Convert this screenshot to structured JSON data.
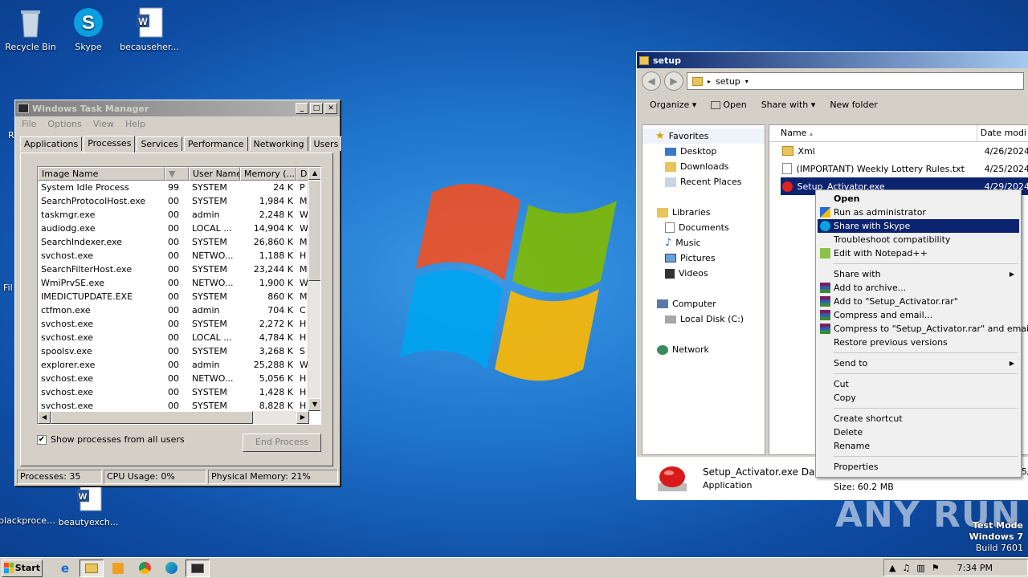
{
  "desktop": {
    "icons": [
      {
        "label": "Recycle Bin",
        "icon": "recycle-bin-icon"
      },
      {
        "label": "Skype",
        "icon": "skype-icon"
      },
      {
        "label": "becauseher...",
        "icon": "word-doc-icon"
      },
      {
        "label": "blackproces...",
        "icon": "blank-doc-icon"
      },
      {
        "label": "beautyexch...",
        "icon": "word-doc-icon"
      }
    ],
    "partial_labels": [
      "R",
      "File"
    ]
  },
  "task_manager": {
    "title": "Windows Task Manager",
    "menu": [
      "File",
      "Options",
      "View",
      "Help"
    ],
    "tabs": [
      "Applications",
      "Processes",
      "Services",
      "Performance",
      "Networking",
      "Users"
    ],
    "active_tab": "Processes",
    "columns": [
      "Image Name",
      "User Name",
      "Memory (...",
      "D"
    ],
    "rows": [
      {
        "name": "System Idle Process",
        "cpu": "99",
        "user": "SYSTEM",
        "mem": "24 K",
        "d": "P"
      },
      {
        "name": "SearchProtocolHost.exe",
        "cpu": "00",
        "user": "SYSTEM",
        "mem": "1,984 K",
        "d": "M"
      },
      {
        "name": "taskmgr.exe",
        "cpu": "00",
        "user": "admin",
        "mem": "2,248 K",
        "d": "W"
      },
      {
        "name": "audiodg.exe",
        "cpu": "00",
        "user": "LOCAL ...",
        "mem": "14,904 K",
        "d": "W"
      },
      {
        "name": "SearchIndexer.exe",
        "cpu": "00",
        "user": "SYSTEM",
        "mem": "26,860 K",
        "d": "M"
      },
      {
        "name": "svchost.exe",
        "cpu": "00",
        "user": "NETWO...",
        "mem": "1,188 K",
        "d": "H"
      },
      {
        "name": "SearchFilterHost.exe",
        "cpu": "00",
        "user": "SYSTEM",
        "mem": "23,244 K",
        "d": "M"
      },
      {
        "name": "WmiPrvSE.exe",
        "cpu": "00",
        "user": "NETWO...",
        "mem": "1,900 K",
        "d": "W"
      },
      {
        "name": "IMEDICTUPDATE.EXE",
        "cpu": "00",
        "user": "SYSTEM",
        "mem": "860 K",
        "d": "M"
      },
      {
        "name": "ctfmon.exe",
        "cpu": "00",
        "user": "admin",
        "mem": "704 K",
        "d": "C"
      },
      {
        "name": "svchost.exe",
        "cpu": "00",
        "user": "SYSTEM",
        "mem": "2,272 K",
        "d": "H"
      },
      {
        "name": "svchost.exe",
        "cpu": "00",
        "user": "LOCAL ...",
        "mem": "4,784 K",
        "d": "H"
      },
      {
        "name": "spoolsv.exe",
        "cpu": "00",
        "user": "SYSTEM",
        "mem": "3,268 K",
        "d": "S"
      },
      {
        "name": "explorer.exe",
        "cpu": "00",
        "user": "admin",
        "mem": "25,288 K",
        "d": "W"
      },
      {
        "name": "svchost.exe",
        "cpu": "00",
        "user": "NETWO...",
        "mem": "5,056 K",
        "d": "H"
      },
      {
        "name": "svchost.exe",
        "cpu": "00",
        "user": "SYSTEM",
        "mem": "1,428 K",
        "d": "H"
      },
      {
        "name": "svchost.exe",
        "cpu": "00",
        "user": "SYSTEM",
        "mem": "8,828 K",
        "d": "H"
      }
    ],
    "show_all_label": "Show processes from all users",
    "show_all_checked": "✔",
    "end_process_label": "End Process",
    "status": {
      "processes": "Processes: 35",
      "cpu": "CPU Usage: 0%",
      "memory": "Physical Memory: 21%"
    }
  },
  "explorer": {
    "title": "setup",
    "address": "setup",
    "commands": [
      "Organize",
      "Open",
      "Share with",
      "New folder"
    ],
    "nav": {
      "favorites": "Favorites",
      "fav_items": [
        "Desktop",
        "Downloads",
        "Recent Places"
      ],
      "libraries": "Libraries",
      "lib_items": [
        "Documents",
        "Music",
        "Pictures",
        "Videos"
      ],
      "computer": "Computer",
      "comp_items": [
        "Local Disk (C:)"
      ],
      "network": "Network"
    },
    "columns": [
      "Name",
      "Date modi"
    ],
    "files": [
      {
        "name": "Xml",
        "date": "4/26/2024",
        "icon": "folder-icon"
      },
      {
        "name": "(IMPORTANT) Weekly Lottery Rules.txt",
        "date": "4/25/2024",
        "icon": "text-file-icon"
      },
      {
        "name": "Setup_Activator.exe",
        "date": "4/29/2024",
        "icon": "installer-icon"
      }
    ],
    "details": {
      "filename": "Setup_Activator.exe",
      "date_label": "Date",
      "type": "Application",
      "size": "Size: 60.2 MB",
      "cut": "5/"
    }
  },
  "context_menu": {
    "items": [
      {
        "label": "Open",
        "bold": true
      },
      {
        "label": "Run as administrator",
        "icon": "shield-icon"
      },
      {
        "label": "Share with Skype",
        "icon": "skype-icon",
        "highlight": true
      },
      {
        "label": "Troubleshoot compatibility"
      },
      {
        "label": "Edit with Notepad++",
        "icon": "notepad-icon"
      },
      {
        "sep": true
      },
      {
        "label": "Share with",
        "submenu": true
      },
      {
        "label": "Add to archive...",
        "icon": "rar-icon"
      },
      {
        "label": "Add to \"Setup_Activator.rar\"",
        "icon": "rar-icon"
      },
      {
        "label": "Compress and email...",
        "icon": "rar-icon"
      },
      {
        "label": "Compress to \"Setup_Activator.rar\" and email",
        "icon": "rar-icon"
      },
      {
        "label": "Restore previous versions"
      },
      {
        "sep": true
      },
      {
        "label": "Send to",
        "submenu": true
      },
      {
        "sep": true
      },
      {
        "label": "Cut"
      },
      {
        "label": "Copy"
      },
      {
        "sep": true
      },
      {
        "label": "Create shortcut"
      },
      {
        "label": "Delete"
      },
      {
        "label": "Rename"
      },
      {
        "sep": true
      },
      {
        "label": "Properties"
      }
    ]
  },
  "taskbar": {
    "start_label": "Start",
    "apps": [
      "ie-icon",
      "explorer-icon",
      "media-icon",
      "chrome-icon",
      "edge-icon",
      "taskmgr-icon"
    ],
    "clock": "7:34 PM"
  },
  "watermark": {
    "line1": "Test Mode",
    "line2": "Windows 7",
    "line3": "Build 7601",
    "anyrun": "ANY RUN"
  },
  "colors": {
    "highlight": "#0c2470",
    "desktop": "#1f74cc"
  }
}
